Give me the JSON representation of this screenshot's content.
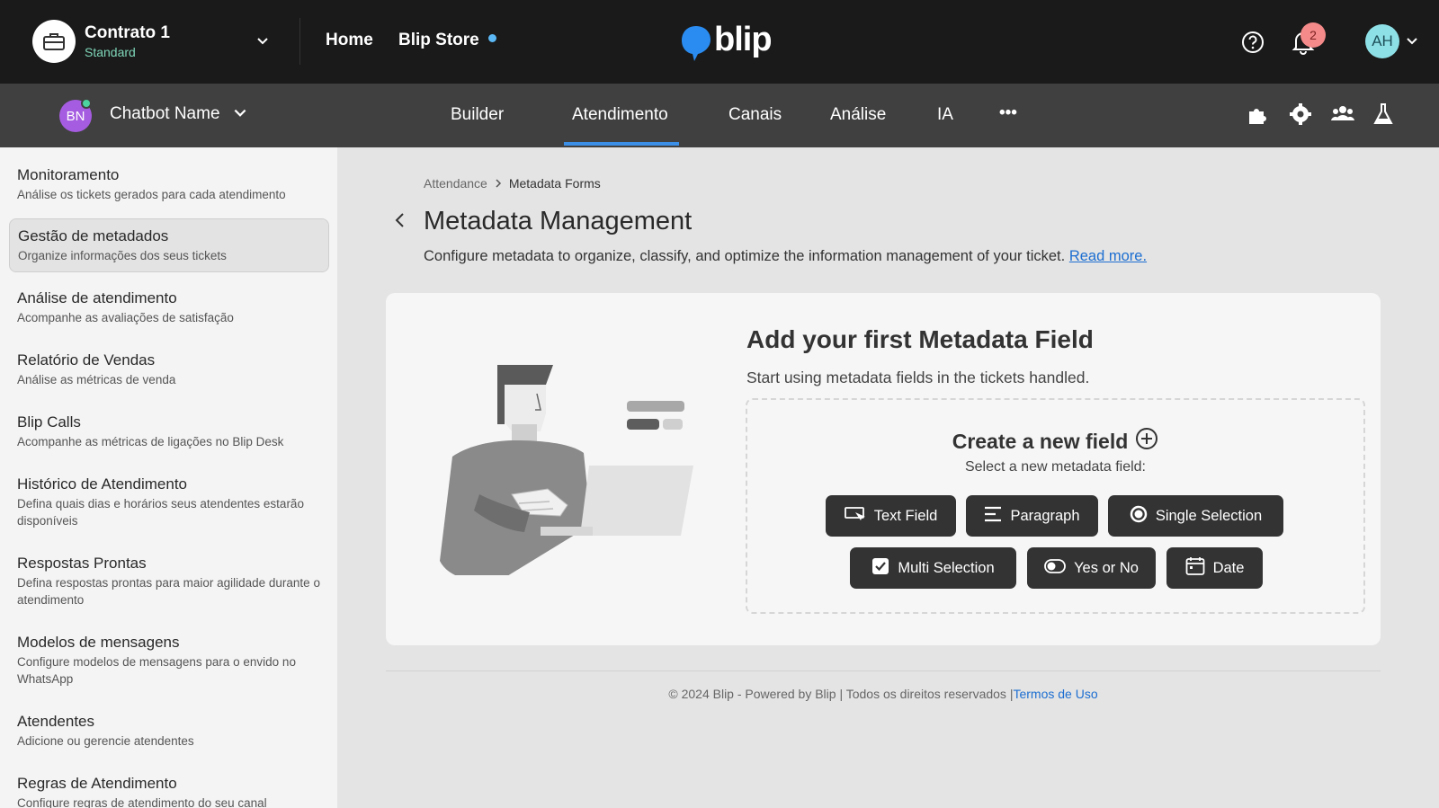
{
  "topbar": {
    "contract_name": "Contrato 1",
    "contract_plan": "Standard",
    "home_label": "Home",
    "store_label": "Blip Store",
    "logo_text": "blip",
    "notification_count": "2",
    "user_initials": "AH"
  },
  "subbar": {
    "bot_initials": "BN",
    "bot_name": "Chatbot Name",
    "tabs": [
      "Builder",
      "Atendimento",
      "Canais",
      "Análise",
      "IA"
    ],
    "active_tab": "Atendimento",
    "more_label": "•••"
  },
  "sidebar": {
    "items": [
      {
        "title": "Monitoramento",
        "subtitle": "Análise os tickets gerados para cada atendimento"
      },
      {
        "title": "Gestão de metadados",
        "subtitle": "Organize informações dos seus tickets"
      },
      {
        "title": "Análise de atendimento",
        "subtitle": "Acompanhe as avaliações de satisfação"
      },
      {
        "title": "Relatório de Vendas",
        "subtitle": "Análise as métricas de venda"
      },
      {
        "title": "Blip Calls",
        "subtitle": "Acompanhe as métricas de ligações no Blip Desk"
      },
      {
        "title": "Histórico de Atendimento",
        "subtitle": "Defina quais dias e horários seus atendentes estarão disponíveis"
      },
      {
        "title": "Respostas Prontas",
        "subtitle": "Defina respostas prontas para maior agilidade durante o atendimento"
      },
      {
        "title": "Modelos de mensagens",
        "subtitle": "Configure modelos de mensagens para o envido no WhatsApp"
      },
      {
        "title": "Atendentes",
        "subtitle": "Adicione ou gerencie atendentes"
      },
      {
        "title": "Regras de Atendimento",
        "subtitle": "Configure regras de atendimento do seu canal"
      }
    ]
  },
  "breadcrumb": {
    "parent": "Attendance",
    "current": "Metadata Forms"
  },
  "page": {
    "title": "Metadata Management",
    "description": "Configure metadata to organize, classify, and optimize the information management of your ticket.",
    "read_more": "Read more."
  },
  "card": {
    "title": "Add your first Metadata Field",
    "subtitle": "Start using metadata fields in the tickets handled.",
    "create_title": "Create a new field",
    "create_sub": "Select a new metadata field:",
    "buttons": [
      "Text Field",
      "Paragraph",
      "Single Selection",
      "Multi Selection",
      "Yes or No",
      "Date"
    ]
  },
  "footer": {
    "text": "© 2024 Blip - Powered by Blip | Todos os direitos reservados |",
    "link": "Termos de Uso"
  },
  "colors": {
    "topbar": "#1a1a1a",
    "subbar": "#404040",
    "accent": "#3b8fe6",
    "link": "#1c6ed1",
    "button": "#333333"
  },
  "icons": [
    "briefcase-icon",
    "chevron-down-icon",
    "help-icon",
    "bell-icon",
    "puzzle-icon",
    "gear-icon",
    "team-icon",
    "flask-icon",
    "back-icon",
    "plus-circle-icon",
    "text-field-icon",
    "paragraph-icon",
    "radio-icon",
    "checkbox-icon",
    "toggle-icon",
    "calendar-icon"
  ]
}
